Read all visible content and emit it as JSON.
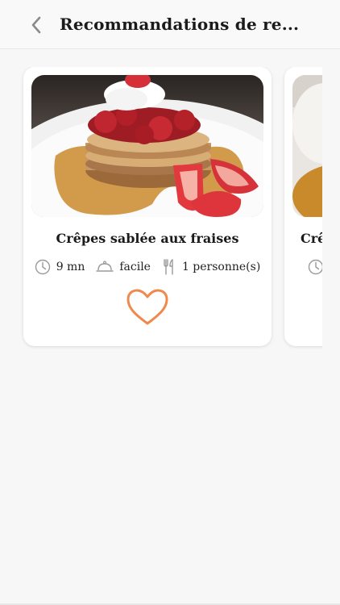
{
  "header": {
    "title": "Recommandations de re..."
  },
  "recipes": [
    {
      "title": "Crêpes sablée aux fraises",
      "time": "9 mn",
      "difficulty": "facile",
      "servings": "1 personne(s)",
      "favorite_color": "#f08a4b"
    },
    {
      "title": "Crê"
    }
  ]
}
